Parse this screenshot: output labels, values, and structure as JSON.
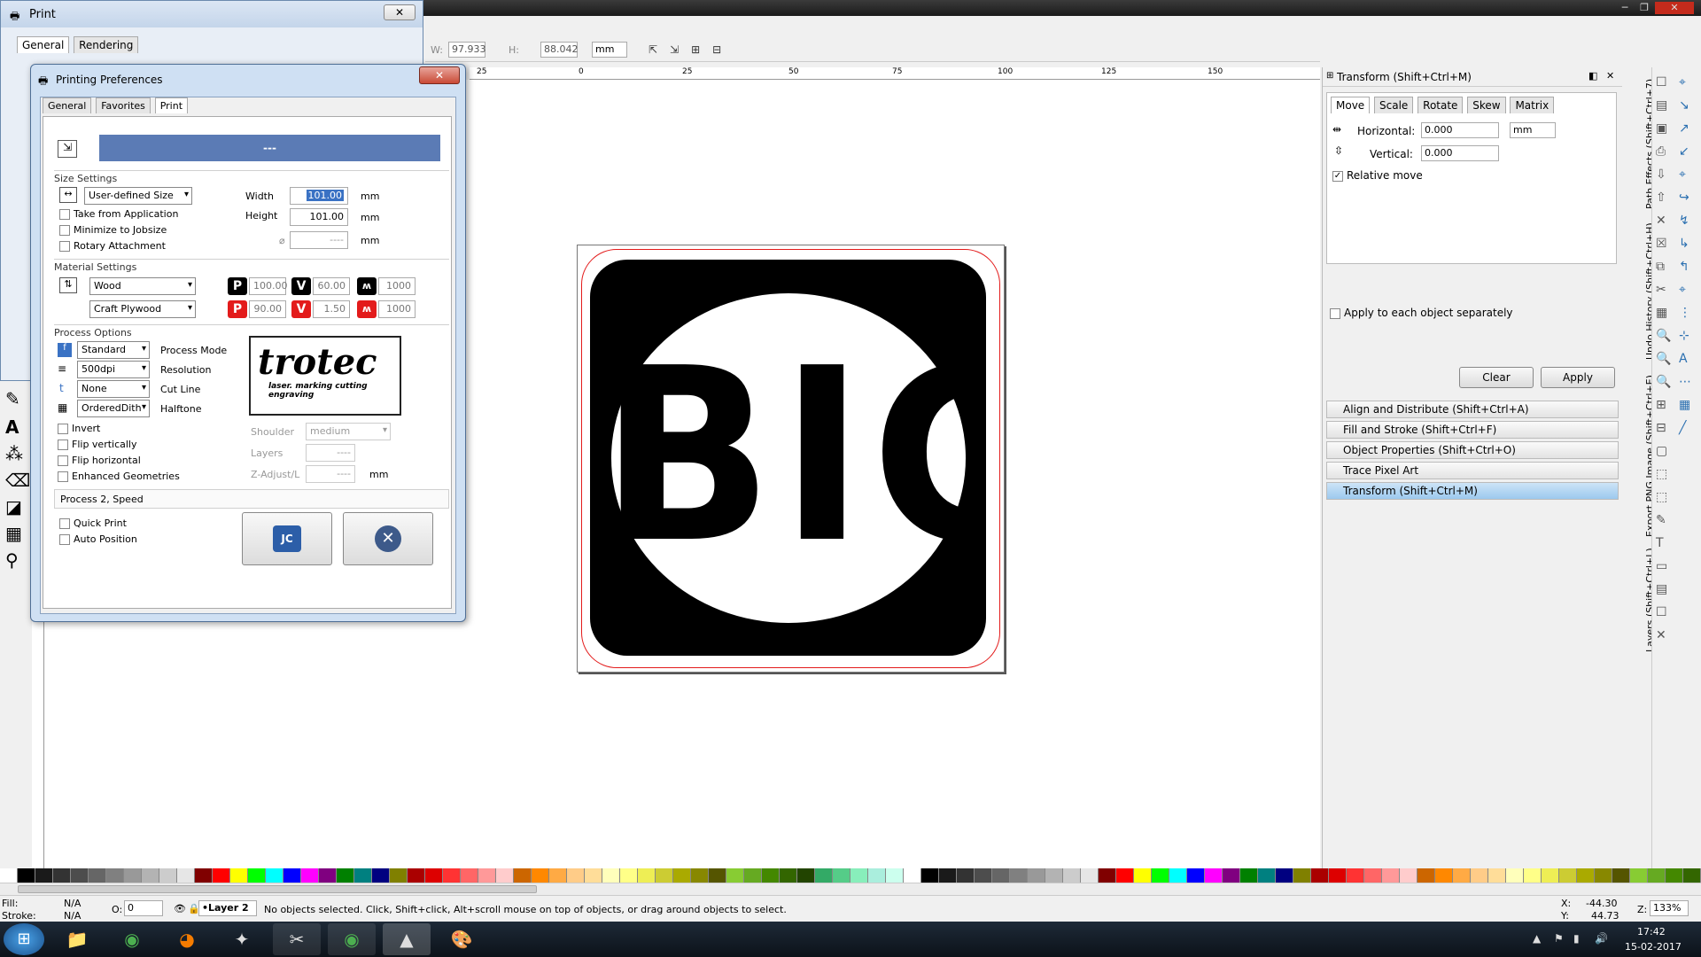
{
  "print_window": {
    "title": "Print",
    "tabs": [
      "General",
      "Rendering"
    ]
  },
  "toolbar": {
    "w_label": "W:",
    "w_value": "97.933",
    "h_label": "H:",
    "h_value": "88.042",
    "unit": "mm"
  },
  "ruler_labels": [
    "25",
    "0",
    "25",
    "50",
    "75",
    "100",
    "125",
    "150"
  ],
  "canvas": {
    "artwork_text": "BIG"
  },
  "pref_dialog": {
    "title": "Printing Preferences",
    "tabs": [
      "General",
      "Favorites",
      "Print"
    ],
    "active_tab": "Print",
    "banner_text": "---",
    "size_settings": {
      "heading": "Size Settings",
      "size_preset": "User-defined Size",
      "width_label": "Width",
      "width_value": "101.00",
      "width_unit": "mm",
      "height_label": "Height",
      "height_value": "101.00",
      "height_unit": "mm",
      "diameter_value": "----",
      "diameter_unit": "mm",
      "checks": [
        "Take from Application",
        "Minimize to Jobsize",
        "Rotary Attachment"
      ]
    },
    "material_settings": {
      "heading": "Material Settings",
      "material": "Wood",
      "material_sub": "Craft Plywood",
      "row1": {
        "p": "100.00",
        "v": "60.00",
        "f": "1000"
      },
      "row2": {
        "p": "90.00",
        "v": "1.50",
        "f": "1000"
      },
      "badges": {
        "p": "P",
        "v": "V"
      }
    },
    "process_options": {
      "heading": "Process Options",
      "process_mode": "Standard",
      "process_mode_label": "Process Mode",
      "resolution": "500dpi",
      "resolution_label": "Resolution",
      "cut_line": "None",
      "cut_line_label": "Cut Line",
      "halftone": "OrderedDith",
      "halftone_label": "Halftone",
      "checks": [
        "Invert",
        "Flip vertically",
        "Flip horizontal",
        "Enhanced Geometries"
      ],
      "shoulder_label": "Shoulder",
      "shoulder_value": "medium",
      "layers_label": "Layers",
      "layers_value": "----",
      "zadjust_label": "Z-Adjust/L",
      "zadjust_value": "----",
      "zadjust_unit": "mm",
      "logo_text": "trotec",
      "logo_tagline": "laser. marking cutting engraving"
    },
    "process2": "Process 2, Speed",
    "bottom_checks": [
      "Quick Print",
      "Auto Position"
    ]
  },
  "transform_panel": {
    "title": "Transform (Shift+Ctrl+M)",
    "tabs": [
      "Move",
      "Scale",
      "Rotate",
      "Skew",
      "Matrix"
    ],
    "horizontal_label": "Horizontal:",
    "horizontal_value": "0.000",
    "vertical_label": "Vertical:",
    "vertical_value": "0.000",
    "unit": "mm",
    "relative_move": "Relative move",
    "apply_each": "Apply to each object separately",
    "clear": "Clear",
    "apply": "Apply"
  },
  "docked_dialogs": [
    "Align and Distribute (Shift+Ctrl+A)",
    "Fill and Stroke (Shift+Ctrl+F)",
    "Object Properties (Shift+Ctrl+O)",
    "Trace Pixel Art",
    "Transform (Shift+Ctrl+M)"
  ],
  "side_tabs": [
    "Path Effects (Shift+Ctrl+7)",
    "Undo History (Shift+Ctrl+H)",
    "Export PNG Image (Shift+Ctrl+E)",
    "Layers (Shift+Ctrl+L)"
  ],
  "status": {
    "fill_label": "Fill:",
    "fill_value": "N/A",
    "stroke_label": "Stroke:",
    "stroke_value": "N/A",
    "opacity_label": "O:",
    "opacity_value": "0",
    "layer": "•Layer 2",
    "message": "No objects selected. Click, Shift+click, Alt+scroll mouse on top of objects, or drag around objects to select.",
    "x_label": "X:",
    "x_value": "-44.30",
    "y_label": "Y:",
    "y_value": "44.73",
    "zoom_label": "Z:",
    "zoom_value": "133%"
  },
  "taskbar": {
    "time": "17:42",
    "date": "15-02-2017"
  },
  "colors": {
    "accent_blue": "#5b7bb5",
    "red": "#e31b1b",
    "artwork_black": "#000000"
  }
}
